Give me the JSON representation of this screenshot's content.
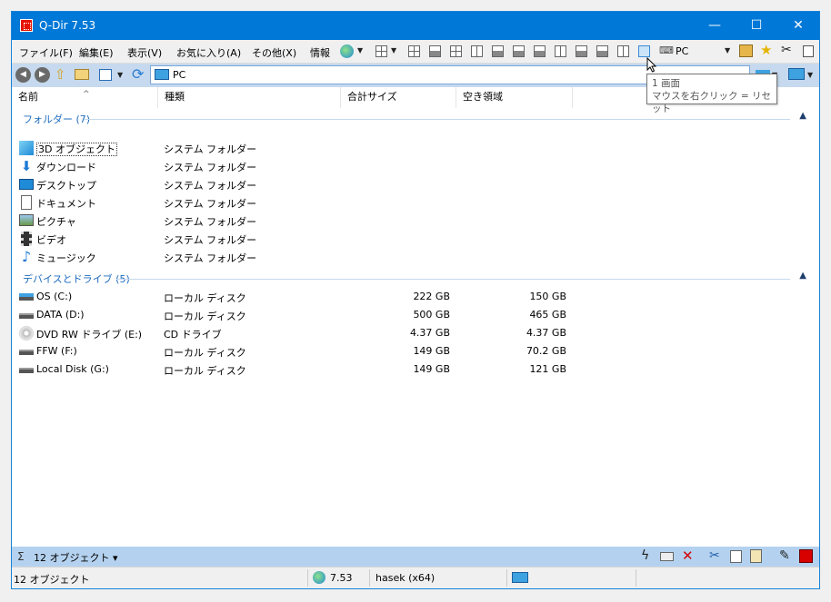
{
  "window": {
    "title": "Q-Dir 7.53",
    "minimize": "—",
    "maximize": "☐",
    "close": "✕"
  },
  "menu": {
    "file": "ファイル(F)",
    "edit": "編集(E)",
    "view": "表示(V)",
    "favorites": "お気に入り(A)",
    "other": "その他(X)",
    "info": "情報",
    "location": "PC"
  },
  "address": {
    "value": "PC"
  },
  "tooltip": {
    "line1": "1 画面",
    "line2": "マウスを右クリック = リセット"
  },
  "columns": {
    "name": "名前",
    "type": "種類",
    "total": "合計サイズ",
    "free": "空き領域"
  },
  "groups": {
    "folders": "フォルダー (7)",
    "drives": "デバイスとドライブ (5)"
  },
  "folders": [
    {
      "name": "3D オブジェクト",
      "type": "システム フォルダー",
      "icon": "cube-icon"
    },
    {
      "name": "ダウンロード",
      "type": "システム フォルダー",
      "icon": "download-icon"
    },
    {
      "name": "デスクトップ",
      "type": "システム フォルダー",
      "icon": "desktop-icon"
    },
    {
      "name": "ドキュメント",
      "type": "システム フォルダー",
      "icon": "document-icon"
    },
    {
      "name": "ピクチャ",
      "type": "システム フォルダー",
      "icon": "picture-icon"
    },
    {
      "name": "ビデオ",
      "type": "システム フォルダー",
      "icon": "video-icon"
    },
    {
      "name": "ミュージック",
      "type": "システム フォルダー",
      "icon": "music-icon"
    }
  ],
  "drives": [
    {
      "name": "OS (C:)",
      "type": "ローカル ディスク",
      "total": "222 GB",
      "free": "150 GB",
      "icon": "os-drive-icon"
    },
    {
      "name": "DATA (D:)",
      "type": "ローカル ディスク",
      "total": "500 GB",
      "free": "465 GB",
      "icon": "drive-icon"
    },
    {
      "name": "DVD RW ドライブ (E:)",
      "type": "CD ドライブ",
      "total": "4.37 GB",
      "free": "4.37 GB",
      "icon": "dvd-icon"
    },
    {
      "name": "FFW (F:)",
      "type": "ローカル ディスク",
      "total": "149 GB",
      "free": "70.2 GB",
      "icon": "drive-icon"
    },
    {
      "name": "Local Disk (G:)",
      "type": "ローカル ディスク",
      "total": "149 GB",
      "free": "121 GB",
      "icon": "drive-icon"
    }
  ],
  "bottombar": {
    "sigma": "Σ",
    "count": "12 オブジェクト ▾"
  },
  "status": {
    "objects": "12 オブジェクト",
    "version": "7.53",
    "user": "hasek (x64)"
  }
}
